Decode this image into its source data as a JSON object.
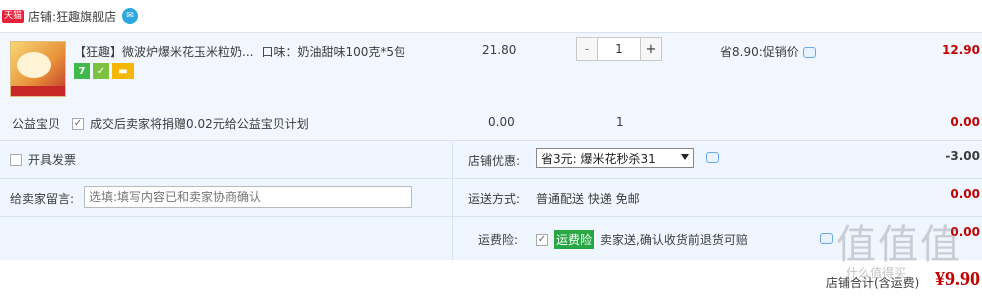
{
  "store": {
    "badge": "天猫",
    "prefix": "店铺:",
    "name": "狂趣旗舰店",
    "ww_icon": "chat-bubble-icon"
  },
  "item": {
    "brand": "【狂趣】",
    "title": "微波炉爆米花玉米粒奶...",
    "sku": "口味：奶油甜味100克*5包",
    "service_icons": [
      "7-day-return-icon",
      "guarantee-icon",
      "credit-card-icon"
    ],
    "service_7": "7",
    "unit_price": "21.80",
    "quantity": "1",
    "minus": "-",
    "plus": "+",
    "save_text": "省8.90:促销价",
    "subtotal": "12.90"
  },
  "charity": {
    "label": "公益宝贝",
    "check_text": "成交后卖家将捐赠0.02元给公益宝贝计划",
    "price": "0.00",
    "qty": "1",
    "subtotal": "0.00"
  },
  "invoice": {
    "label": "开具发票"
  },
  "promo": {
    "label": "店铺优惠:",
    "selected": "省3元: 爆米花秒杀31",
    "amount": "-3.00"
  },
  "message": {
    "label": "给卖家留言:",
    "placeholder": "选填:填写内容已和卖家协商确认"
  },
  "shipping": {
    "label": "运送方式:",
    "value": "普通配送 快递 免邮",
    "amount": "0.00"
  },
  "insurance": {
    "label": "运费险:",
    "badge": "运费险",
    "text": "卖家送,确认收货前退货可赔",
    "amount": "0.00"
  },
  "total": {
    "label": "店铺合计(含运费)",
    "amount": "¥9.90"
  },
  "watermark": {
    "text": "值值值",
    "small": "什么值得买"
  },
  "colors": {
    "accent_red": "#c40000",
    "row_bg": "#f0f6ff",
    "tmall_red": "#e8203a"
  }
}
